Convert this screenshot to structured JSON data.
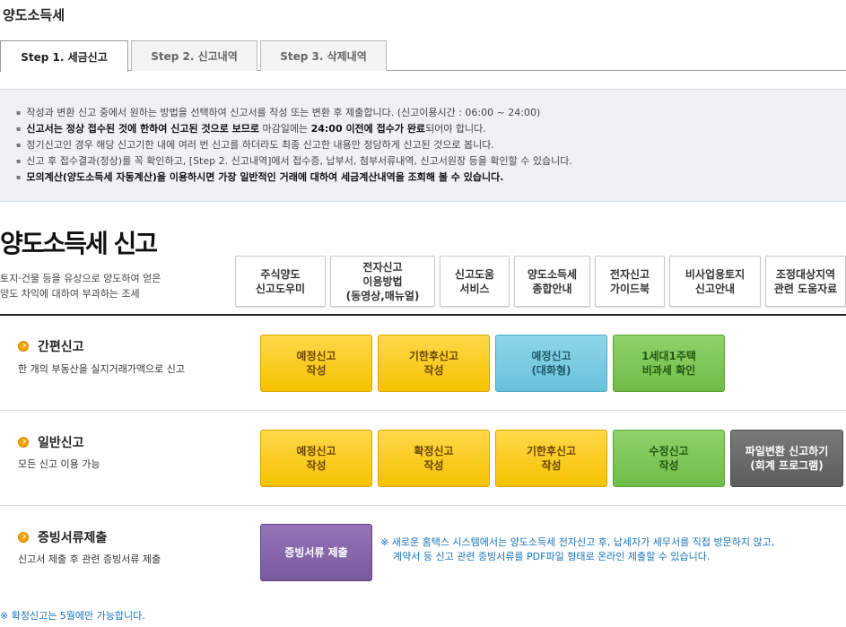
{
  "page": {
    "title": "양도소득세"
  },
  "tabs": [
    {
      "label": "Step 1. 세금신고"
    },
    {
      "label": "Step 2. 신고내역"
    },
    {
      "label": "Step 3. 삭제내역"
    }
  ],
  "notice": {
    "line1": "작성과 변환 신고 중에서 원하는 방법을 선택하여 신고서를 작성 또는 변환 후 제출합니다. (신고이용시간 : 06:00 ~ 24:00)",
    "line2_a": "신고서는 정상 접수된 것에 한하여 신고된 것으로 보므로",
    "line2_b": " 마감일에는 ",
    "line2_c": "24:00 이전에 접수가 완료",
    "line2_d": "되어야 합니다.",
    "line3": "정기신고인 경우 해당 신고기한 내에 여러 번 신고를 하더라도 최종 신고한 내용만 정당하게 신고된 것으로 봅니다.",
    "line4": "신고 후 접수결과(정상)를 꼭 확인하고, [Step 2. 신고내역]에서 접수증, 납부서, 첨부서류내역, 신고서원장 등을 확인할 수 있습니다.",
    "line5": "모의계산(양도소득세 자동계산)을 이용하시면 가장 일반적인 거래에 대하여 세금계산내역을 조회해 볼 수 있습니다."
  },
  "main": {
    "title": "양도소득세 신고",
    "desc_line1": "토지·건물 등을 유상으로 양도하여 얻은",
    "desc_line2": "양도 차익에 대하여 부과하는 조세"
  },
  "quick_links": [
    {
      "label": "주식양도\n신고도우미"
    },
    {
      "label": "전자신고\n이용방법\n(동영상,매뉴얼)"
    },
    {
      "label": "신고도움\n서비스"
    },
    {
      "label": "양도소득세\n종합안내"
    },
    {
      "label": "전자신고\n가이드북"
    },
    {
      "label": "비사업용토지\n신고안내"
    },
    {
      "label": "조정대상지역\n관련 도움자료"
    }
  ],
  "sections": {
    "simple": {
      "title": "간편신고",
      "sub": "한 개의 부동산을 실지거래가액으로 신고",
      "buttons": [
        {
          "label": "예정신고\n작성",
          "color": "#f6c200"
        },
        {
          "label": "기한후신고\n작성",
          "color": "#f6c200"
        },
        {
          "label": "예정신고\n(대화형)",
          "color": "#69c2dc"
        },
        {
          "label": "1세대1주택\n비과세 확인",
          "color": "#6fbd48"
        }
      ]
    },
    "general": {
      "title": "일반신고",
      "sub": "모든 신고 이용 가능",
      "buttons": [
        {
          "label": "예정신고\n작성",
          "color": "#f6c200"
        },
        {
          "label": "확정신고\n작성",
          "color": "#f6c200"
        },
        {
          "label": "기한후신고\n작성",
          "color": "#f6c200"
        },
        {
          "label": "수정신고\n작성",
          "color": "#6fbd48"
        },
        {
          "label": "파일변환 신고하기\n(회계 프로그램)",
          "color": "#5c5c5c"
        }
      ]
    },
    "evidence": {
      "title": "증빙서류제출",
      "sub": "신고서 제출 후 관련 증빙서류 제출",
      "button": "증빙서류 제출",
      "note_line1": "※ 새로운 홈택스 시스템에서는 양도소득세 전자신고 후, 납세자가 세무서를 직접 방문하지 않고,",
      "note_line2": "계약서 등 신고 관련 증빙서류를 PDF파일 형태로 온라인 제출할 수 있습니다."
    }
  },
  "footer": {
    "note": "※ 확정신고는 5월에만 가능합니다."
  }
}
